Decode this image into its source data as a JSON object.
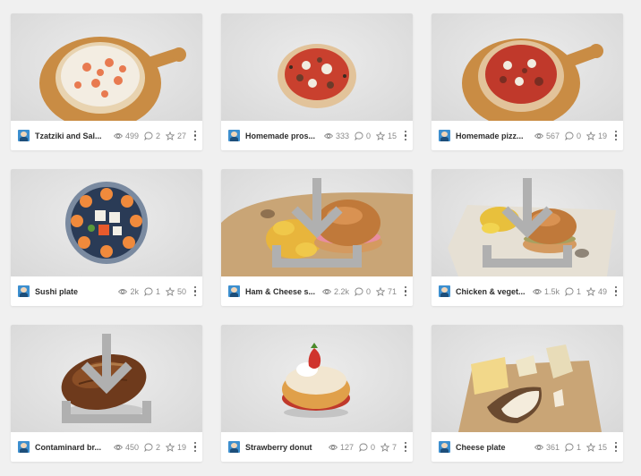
{
  "cards": [
    {
      "title": "Tzatziki and Sal...",
      "views": "499",
      "comments": "2",
      "likes": "27",
      "thumbnail": "pizza-on-board",
      "downloadable": false
    },
    {
      "title": "Homemade pros...",
      "views": "333",
      "comments": "0",
      "likes": "15",
      "thumbnail": "pizza",
      "downloadable": false
    },
    {
      "title": "Homemade pizz...",
      "views": "567",
      "comments": "0",
      "likes": "19",
      "thumbnail": "pizza-on-board",
      "downloadable": false
    },
    {
      "title": "Sushi plate",
      "views": "2k",
      "comments": "1",
      "likes": "50",
      "thumbnail": "sushi-plate",
      "downloadable": false
    },
    {
      "title": "Ham & Cheese s...",
      "views": "2.2k",
      "comments": "0",
      "likes": "71",
      "thumbnail": "sandwich-chips",
      "downloadable": true
    },
    {
      "title": "Chicken & veget...",
      "views": "1.5k",
      "comments": "1",
      "likes": "49",
      "thumbnail": "sandwich-chips",
      "downloadable": true
    },
    {
      "title": "Contaminard br...",
      "views": "450",
      "comments": "2",
      "likes": "19",
      "thumbnail": "bread-loaf",
      "downloadable": true
    },
    {
      "title": "Strawberry donut",
      "views": "127",
      "comments": "0",
      "likes": "7",
      "thumbnail": "donut",
      "downloadable": false
    },
    {
      "title": "Cheese plate",
      "views": "361",
      "comments": "1",
      "likes": "15",
      "thumbnail": "cheese-board",
      "downloadable": false
    }
  ],
  "icons": {
    "views": "eye-icon",
    "comments": "comment-icon",
    "likes": "star-icon",
    "menu": "more-vertical-icon",
    "download": "download-icon",
    "avatar": "user-avatar"
  },
  "colors": {
    "background": "#f0f0f0",
    "card": "#ffffff",
    "thumb": "#dedede",
    "title_text": "#2c2c2c",
    "stat_text": "#8a8a8a",
    "avatar": "#3d8fcf"
  }
}
